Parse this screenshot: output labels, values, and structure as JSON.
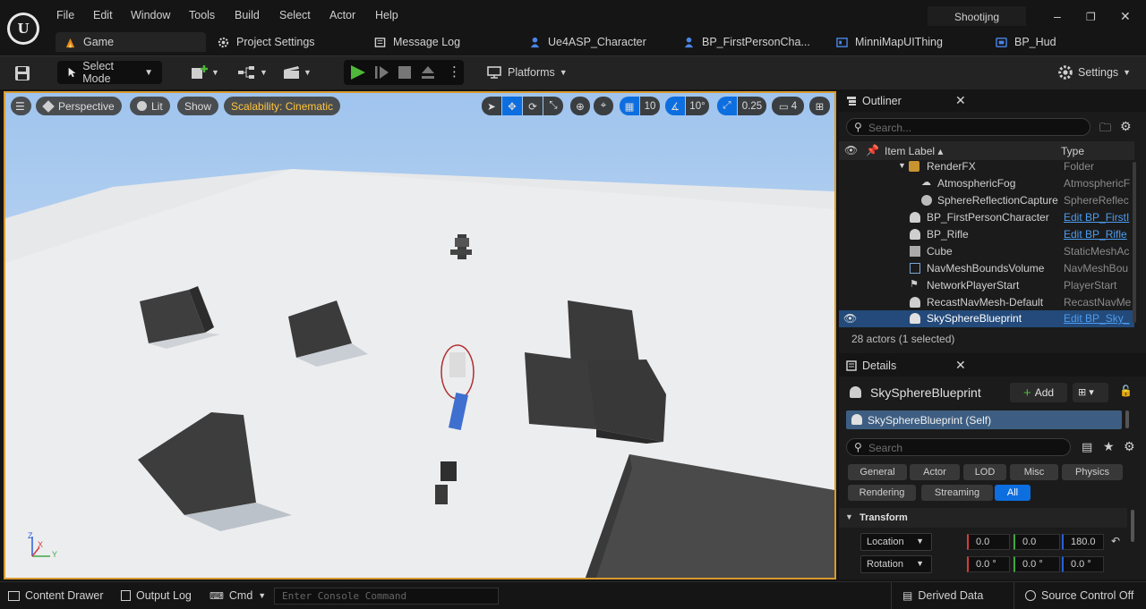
{
  "app": {
    "logo": "U",
    "project_name": "Shootijng"
  },
  "menu": [
    "File",
    "Edit",
    "Window",
    "Tools",
    "Build",
    "Select",
    "Actor",
    "Help"
  ],
  "window_controls": [
    "–",
    "❐",
    "✕"
  ],
  "tabs": [
    {
      "label": "Game",
      "icon": "game-level-icon"
    },
    {
      "label": "Project Settings",
      "icon": "settings-icon"
    },
    {
      "label": "Message Log",
      "icon": "log-icon"
    },
    {
      "label": "Ue4ASP_Character",
      "icon": "character-icon"
    },
    {
      "label": "BP_FirstPersonCha...",
      "icon": "character-icon"
    },
    {
      "label": "MinniMapUIThing",
      "icon": "widget-icon"
    },
    {
      "label": "BP_Hud",
      "icon": "blueprint-icon"
    }
  ],
  "toolbar": {
    "select_mode": "Select Mode",
    "platforms": "Platforms",
    "settings": "Settings"
  },
  "viewport": {
    "perspective": "Perspective",
    "lit": "Lit",
    "show": "Show",
    "scalability": "Scalability: Cinematic",
    "grid_size": "10",
    "rotation_snap": "10°",
    "scale_snap": "0.25",
    "camera_speed": "4",
    "axis_labels": {
      "x": "X",
      "y": "Y",
      "z": "Z"
    }
  },
  "outliner": {
    "title": "Outliner",
    "search_placeholder": "Search...",
    "col_label": "Item Label ▴",
    "col_type": "Type",
    "rows": [
      {
        "label": "RenderFX",
        "type": "Folder",
        "link": false
      },
      {
        "label": "AtmosphericFog",
        "type": "AtmosphericF",
        "link": false
      },
      {
        "label": "SphereReflectionCapture",
        "type": "SphereReflec",
        "link": false
      },
      {
        "label": "BP_FirstPersonCharacter",
        "type": "Edit BP_FirstI",
        "link": true
      },
      {
        "label": "BP_Rifle",
        "type": "Edit BP_Rifle",
        "link": true
      },
      {
        "label": "Cube",
        "type": "StaticMeshAc",
        "link": false
      },
      {
        "label": "NavMeshBoundsVolume",
        "type": "NavMeshBou",
        "link": false
      },
      {
        "label": "NetworkPlayerStart",
        "type": "PlayerStart",
        "link": false
      },
      {
        "label": "RecastNavMesh-Default",
        "type": "RecastNavMe",
        "link": false
      },
      {
        "label": "SkySphereBlueprint",
        "type": "Edit BP_Sky_",
        "link": true
      }
    ],
    "status": "28 actors (1 selected)"
  },
  "details": {
    "title": "Details",
    "actor_name": "SkySphereBlueprint",
    "add_label": "Add",
    "component": "SkySphereBlueprint (Self)",
    "search_placeholder": "Search",
    "categories_row1": [
      "General",
      "Actor",
      "LOD",
      "Misc",
      "Physics"
    ],
    "categories_row2": [
      "Rendering",
      "Streaming",
      "All"
    ],
    "section": "Transform",
    "location_label": "Location",
    "location": [
      "0.0",
      "0.0",
      "180.0"
    ],
    "rotation_label": "Rotation",
    "rotation": [
      "0.0 °",
      "0.0 °",
      "0.0 °"
    ]
  },
  "statusbar": {
    "content_drawer": "Content Drawer",
    "output_log": "Output Log",
    "cmd": "Cmd",
    "console_placeholder": "Enter Console Command",
    "derived_data": "Derived Data",
    "source_control": "Source Control Off"
  },
  "colors": {
    "accent": "#d99a2f",
    "selection": "#0d6ee0",
    "link": "#4d9cf0",
    "play": "#4fb83a"
  }
}
